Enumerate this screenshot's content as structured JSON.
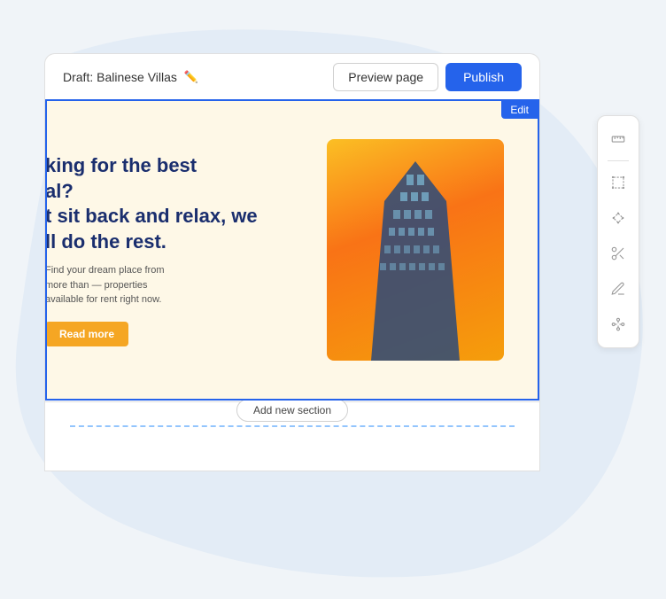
{
  "page": {
    "title": "Draft: Balinese Villas",
    "edit_icon": "✏️"
  },
  "header": {
    "preview_label": "Preview page",
    "publish_label": "Publish",
    "draft_title": "Draft: Balinese Villas"
  },
  "hero": {
    "heading_line1": "king for the best",
    "heading_line2": "al?",
    "heading_line3": "t sit back and relax, we",
    "heading_line4": "ll do the rest.",
    "subtext": "Find your dream place from more than — properties available for rent right now.",
    "read_more_label": "Read more"
  },
  "editor": {
    "edit_badge": "Edit",
    "add_section_label": "Add new section"
  },
  "toolbar": {
    "items": [
      {
        "name": "ruler-icon",
        "label": "Ruler"
      },
      {
        "name": "select-icon",
        "label": "Select"
      },
      {
        "name": "transform-icon",
        "label": "Transform"
      },
      {
        "name": "scissor-icon",
        "label": "Scissor"
      },
      {
        "name": "pen-icon",
        "label": "Pen"
      },
      {
        "name": "nodes-icon",
        "label": "Nodes"
      }
    ]
  }
}
